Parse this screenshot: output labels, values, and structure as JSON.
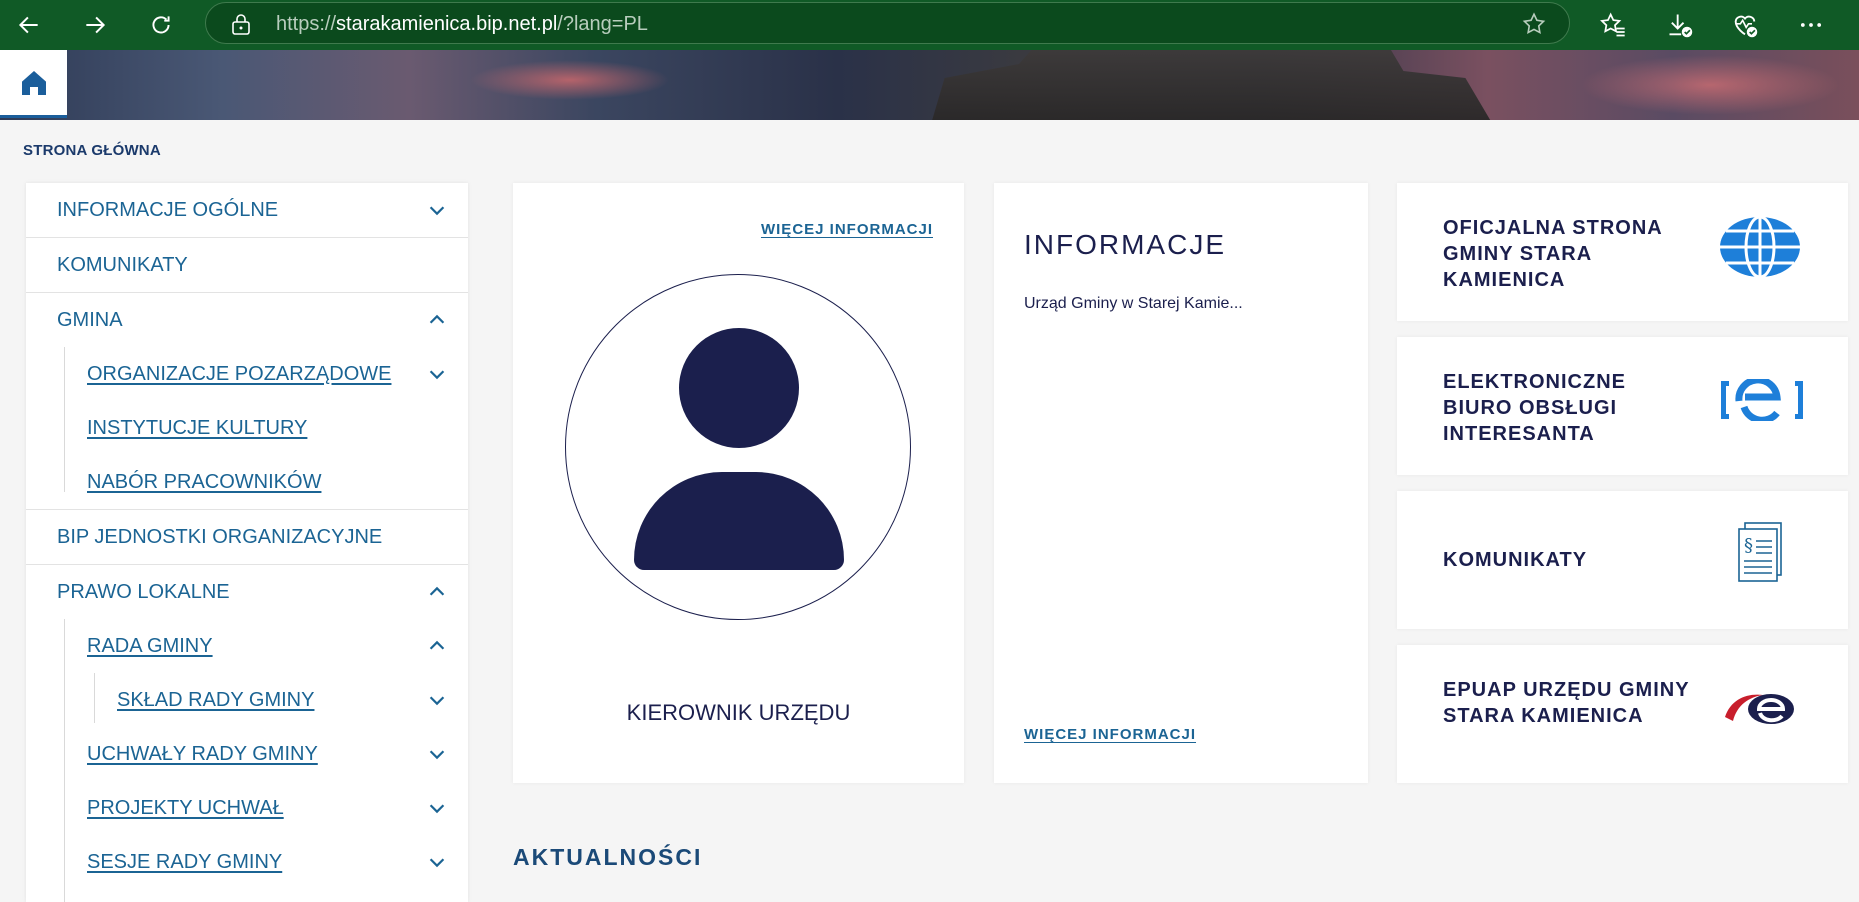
{
  "browser": {
    "url_domain": "starakamienica.bip.net.pl",
    "url_prefix": "https://",
    "url_suffix": "/?lang=PL"
  },
  "breadcrumb": "STRONA GŁÓWNA",
  "sidebar": {
    "items": [
      {
        "label": "INFORMACJE OGÓLNE",
        "chevron": "down"
      },
      {
        "label": "KOMUNIKATY",
        "chevron": ""
      },
      {
        "label": "GMINA",
        "chevron": "up"
      },
      {
        "label": "ORGANIZACJE POZARZĄDOWE",
        "chevron": "down"
      },
      {
        "label": "INSTYTUCJE KULTURY",
        "chevron": ""
      },
      {
        "label": "NABÓR PRACOWNIKÓW",
        "chevron": ""
      },
      {
        "label": "BIP JEDNOSTKI ORGANIZACYJNE",
        "chevron": ""
      },
      {
        "label": "PRAWO LOKALNE",
        "chevron": "up"
      },
      {
        "label": "RADA GMINY",
        "chevron": "up"
      },
      {
        "label": "SKŁAD RADY GMINY",
        "chevron": "down"
      },
      {
        "label": "UCHWAŁY RADY GMINY",
        "chevron": "down"
      },
      {
        "label": "PROJEKTY UCHWAŁ",
        "chevron": "down"
      },
      {
        "label": "SESJE RADY GMINY",
        "chevron": "down"
      }
    ]
  },
  "kierownik_card": {
    "more_label": "WIĘCEJ INFORMACJI",
    "title": "KIEROWNIK URZĘDU"
  },
  "info_card": {
    "title": "INFORMACJE",
    "text": "Urząd Gminy w Starej Kamie...",
    "more_label": "WIĘCEJ INFORMACJI"
  },
  "quick_links": [
    {
      "label": "OFICJALNA STRONA GMINY STARA KAMIENICA",
      "icon": "globe-icon",
      "color": "#1e7fd9"
    },
    {
      "label": "ELEKTRONICZNE BIURO OBSŁUGI INTERESANTA",
      "icon": "ebok-icon",
      "color": "#1e7fd9"
    },
    {
      "label": "KOMUNIKATY",
      "icon": "document-paragraph-icon",
      "color": "#1b6494"
    },
    {
      "label": "EPUAP URZĘDU GMINY STARA KAMIENICA",
      "icon": "epuap-icon",
      "color": "#c81e2c"
    }
  ],
  "news": {
    "title": "AKTUALNOŚCI"
  },
  "colors": {
    "browser_bar": "#105a26",
    "link": "#1b6494",
    "navy": "#1b1f4d"
  }
}
